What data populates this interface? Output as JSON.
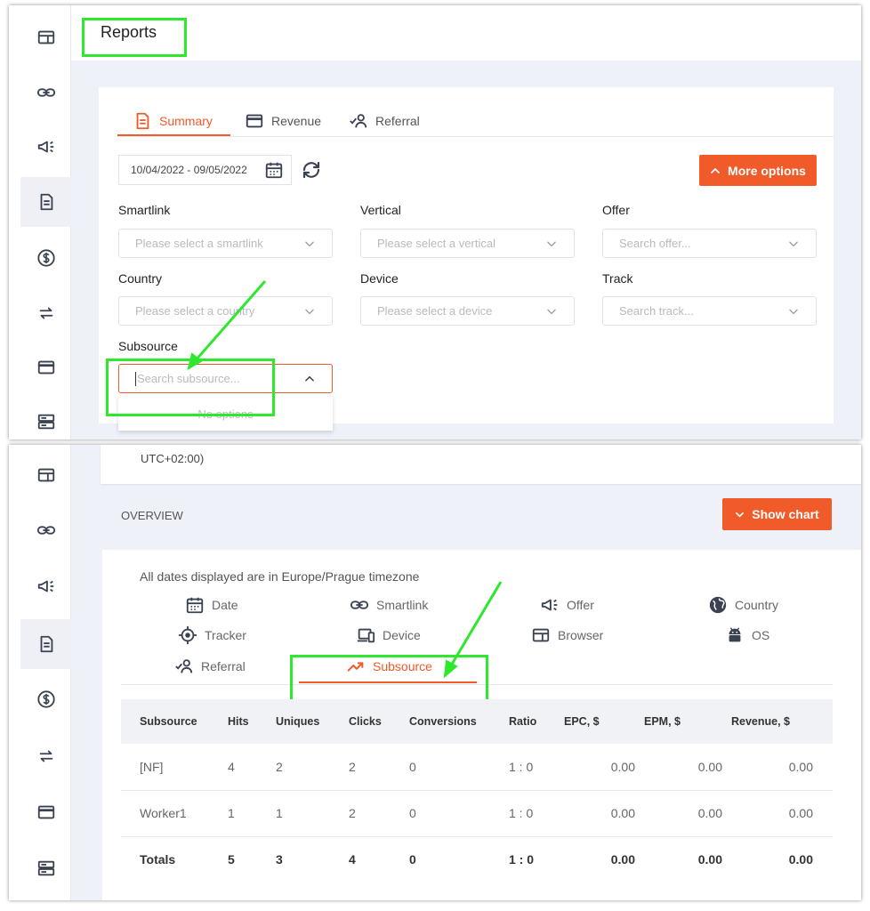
{
  "page": {
    "title": "Reports"
  },
  "sidebar": {
    "items": [
      {
        "icon": "dashboard-icon"
      },
      {
        "icon": "link-icon"
      },
      {
        "icon": "megaphone-icon"
      },
      {
        "icon": "document-icon",
        "active": true
      },
      {
        "icon": "dollar-icon"
      },
      {
        "icon": "transfer-icon"
      },
      {
        "icon": "card-icon"
      },
      {
        "icon": "server-icon"
      }
    ]
  },
  "tabs": [
    {
      "label": "Summary",
      "icon": "document-icon",
      "active": true
    },
    {
      "label": "Revenue",
      "icon": "card-icon"
    },
    {
      "label": "Referral",
      "icon": "referral-icon"
    }
  ],
  "filters": {
    "date_range": "10/04/2022 - 09/05/2022",
    "more_options": "More options",
    "smartlink": {
      "label": "Smartlink",
      "placeholder": "Please select a smartlink"
    },
    "vertical": {
      "label": "Vertical",
      "placeholder": "Please select a vertical"
    },
    "offer": {
      "label": "Offer",
      "placeholder": "Search offer..."
    },
    "country": {
      "label": "Country",
      "placeholder": "Please select a country"
    },
    "device": {
      "label": "Device",
      "placeholder": "Please select a device"
    },
    "track": {
      "label": "Track",
      "placeholder": "Search track..."
    },
    "subsource": {
      "label": "Subsource",
      "placeholder": "Search subsource...",
      "no_options": "No options"
    }
  },
  "overview": {
    "timezone_fragment": "UTC+02:00)",
    "heading": "OVERVIEW",
    "show_chart": "Show chart",
    "timezone_note": "All dates displayed are in Europe/Prague timezone",
    "group_by": [
      {
        "label": "Date",
        "icon": "calendar-icon"
      },
      {
        "label": "Smartlink",
        "icon": "link-icon"
      },
      {
        "label": "Offer",
        "icon": "megaphone-icon"
      },
      {
        "label": "Country",
        "icon": "globe-icon"
      },
      {
        "label": "Tracker",
        "icon": "target-icon"
      },
      {
        "label": "Device",
        "icon": "devices-icon"
      },
      {
        "label": "Browser",
        "icon": "browser-icon"
      },
      {
        "label": "OS",
        "icon": "android-icon"
      },
      {
        "label": "Referral",
        "icon": "referral-icon"
      },
      {
        "label": "Subsource",
        "icon": "trend-icon",
        "active": true
      }
    ]
  },
  "table": {
    "headers": [
      "Subsource",
      "Hits",
      "Uniques",
      "Clicks",
      "Conversions",
      "Ratio",
      "EPC, $",
      "EPM, $",
      "Revenue, $"
    ],
    "rows": [
      [
        "[NF]",
        "4",
        "2",
        "2",
        "0",
        "1 : 0",
        "0.00",
        "0.00",
        "0.00"
      ],
      [
        "Worker1",
        "1",
        "1",
        "2",
        "0",
        "1 : 0",
        "0.00",
        "0.00",
        "0.00"
      ]
    ],
    "totals": [
      "Totals",
      "5",
      "3",
      "4",
      "0",
      "1 : 0",
      "0.00",
      "0.00",
      "0.00"
    ]
  },
  "colors": {
    "accent": "#f15a29",
    "highlight": "#2ee82e"
  }
}
